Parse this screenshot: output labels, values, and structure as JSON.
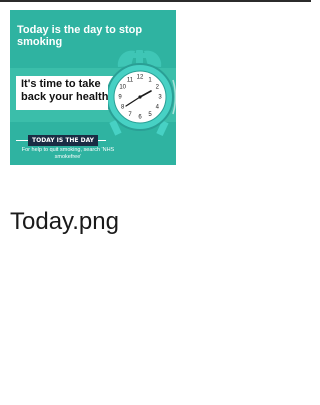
{
  "thumbnail": {
    "headline": "Today is the day to stop smoking",
    "message": "It's time to take back your health!",
    "badge": "TODAY IS THE DAY",
    "footer": "For help to quit smoking, search 'NHS smokefree'",
    "clock_numbers": [
      "12",
      "1",
      "2",
      "3",
      "4",
      "5",
      "6",
      "7",
      "8",
      "9",
      "10",
      "11"
    ],
    "colors": {
      "background": "#2fb3a1",
      "panel": "#3ec0ad",
      "clock_body": "#47d1c4",
      "badge": "#1a2d44"
    }
  },
  "file": {
    "name": "Today.png"
  }
}
